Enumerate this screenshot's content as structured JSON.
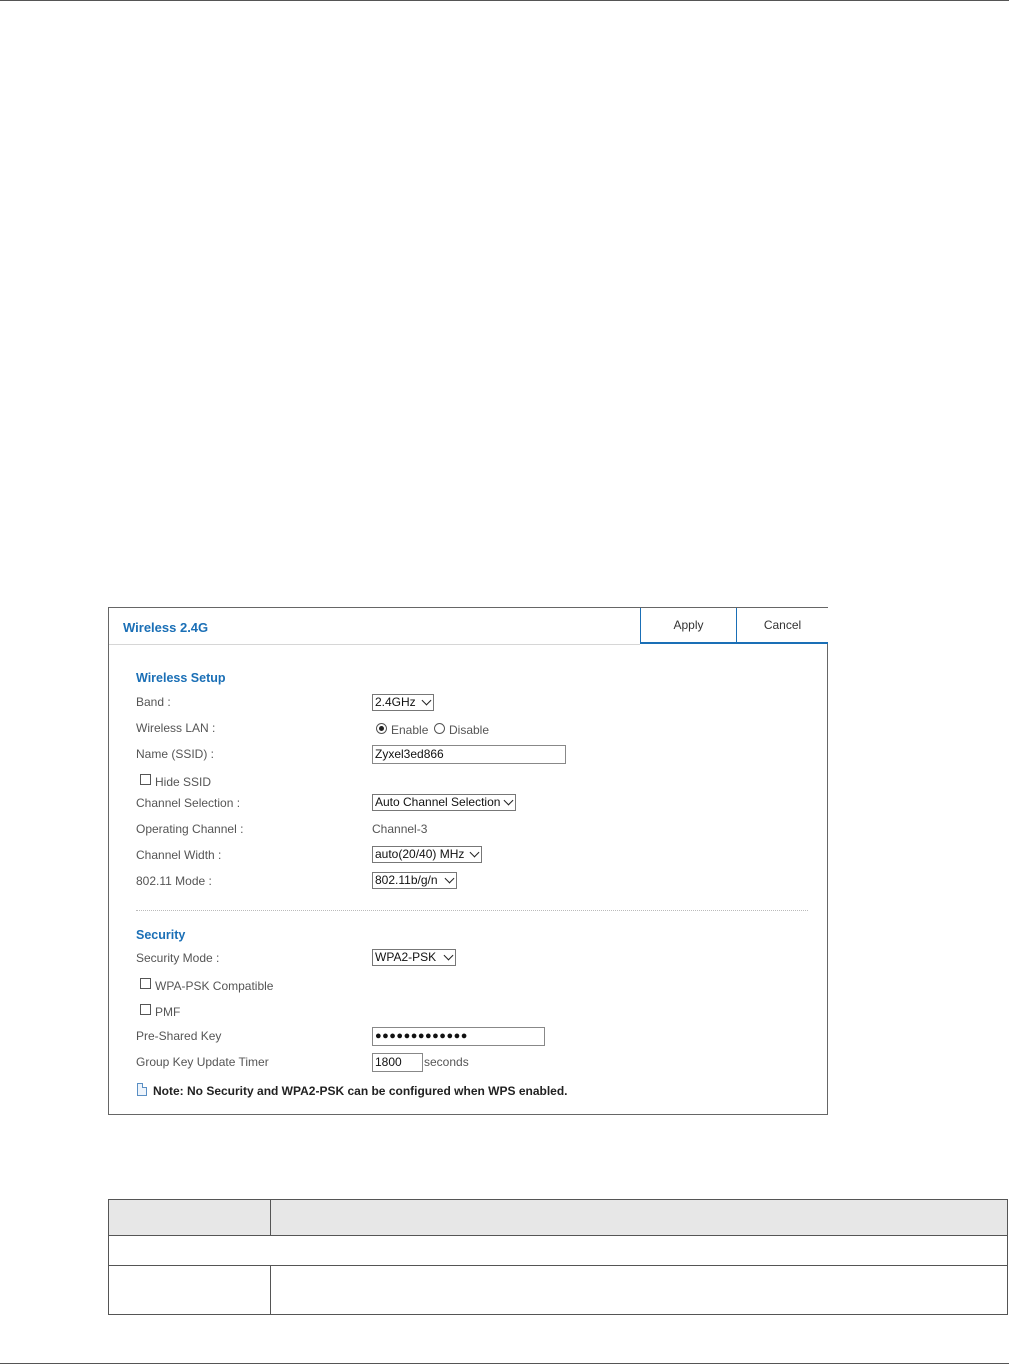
{
  "panel": {
    "title": "Wireless 2.4G",
    "buttons": {
      "apply": "Apply",
      "cancel": "Cancel"
    }
  },
  "wireless_setup": {
    "section_title": "Wireless Setup",
    "band": {
      "label": "Band :",
      "value": "2.4GHz"
    },
    "wireless_lan": {
      "label": "Wireless LAN :",
      "options": [
        "Enable",
        "Disable"
      ],
      "selected": "Enable"
    },
    "ssid": {
      "label": "Name (SSID) :",
      "value": "Zyxel3ed866"
    },
    "hide_ssid": {
      "label": "Hide SSID",
      "checked": false
    },
    "channel_selection": {
      "label": "Channel Selection :",
      "value": "Auto Channel Selection"
    },
    "operating_channel": {
      "label": "Operating Channel :",
      "value": "Channel-3"
    },
    "channel_width": {
      "label": "Channel Width :",
      "value": "auto(20/40) MHz"
    },
    "mode_80211": {
      "label": "802.11 Mode :",
      "value": "802.11b/g/n"
    }
  },
  "security": {
    "section_title": "Security",
    "security_mode": {
      "label": "Security Mode :",
      "value": "WPA2-PSK"
    },
    "wpa_psk_compatible": {
      "label": "WPA-PSK Compatible",
      "checked": false
    },
    "pmf": {
      "label": "PMF",
      "checked": false
    },
    "pre_shared_key": {
      "label": "Pre-Shared Key",
      "value": "●●●●●●●●●●●●●"
    },
    "group_key_timer": {
      "label": "Group Key Update Timer",
      "value": "1800",
      "unit": "seconds"
    }
  },
  "note": "Note: No Security and WPA2-PSK can be configured when WPS enabled.",
  "colors": {
    "accent": "#1a6fb6"
  }
}
